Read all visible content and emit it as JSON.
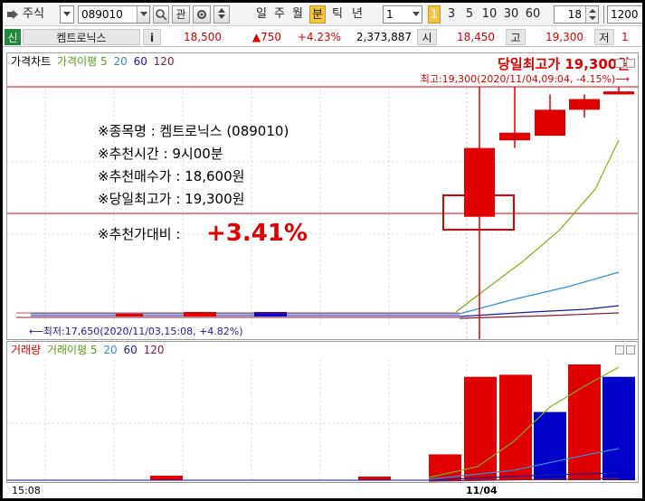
{
  "toolbar": {
    "market_label": "주식",
    "code_value": "089010",
    "gwan_label": "관",
    "periods": [
      "일",
      "주",
      "월",
      "분",
      "틱",
      "년"
    ],
    "active_period": "분",
    "interval_value": "1",
    "quick_intervals": [
      "1",
      "3",
      "5",
      "10",
      "30",
      "60"
    ],
    "count_value": "18",
    "max_value": "1200"
  },
  "quote": {
    "tag": "신",
    "name": "켐트로닉스",
    "info_icon": "i",
    "price": "18,500",
    "change": "▲750",
    "change_rate": "+4.23%",
    "volume": "2,373,887",
    "open_label": "시",
    "open": "18,450",
    "high_label": "고",
    "high": "19,300",
    "low_label": "저",
    "low_value": "1"
  },
  "price_panel": {
    "legend_title": "가격차트",
    "legend_ma_label": "가격이평 5",
    "legend_ma_periods": [
      "20",
      "60",
      "120"
    ],
    "headline": "당일최고가 19,300원",
    "high_note": "최고:19,300(2020/11/04,09:04, -4.15%)⟶",
    "low_note": "⟵최저:17,650(2020/11/03,15:08, +4.82%)",
    "info_lines": [
      "※종목명 : 켐트로닉스 (089010)",
      "※추천시간 : 9시00분",
      "※추천매수가 : 18,600원",
      "※당일최고가 : 19,300원"
    ],
    "compare_label": "※추천가대비 :",
    "compare_value": "+3.41%"
  },
  "volume_panel": {
    "legend_title": "거래량",
    "legend_ma_label": "거래이평 5",
    "legend_ma_periods": [
      "20",
      "60",
      "120"
    ]
  },
  "x_axis": {
    "left_label": "15:08",
    "mid_label": "11/04"
  },
  "colors": {
    "up": "#e00000",
    "down": "#0000c8",
    "ma5": "#7ab317",
    "ma20": "#2f8fd8",
    "ma60": "#1a1aa0",
    "ma120": "#8b1a3a",
    "accent": "#e00000"
  },
  "chart_data": {
    "type": "candlestick",
    "note": "values estimated from pixels; left segment is the prior day's flat close",
    "candles": [
      {
        "open": 18450,
        "high": 19300,
        "low": 17650,
        "close": 18900,
        "dir": "up"
      },
      {
        "open": 18950,
        "high": 19300,
        "low": 18900,
        "close": 19000,
        "dir": "up"
      },
      {
        "open": 18980,
        "high": 19250,
        "low": 18980,
        "close": 19150,
        "dir": "up"
      },
      {
        "open": 19150,
        "high": 19250,
        "low": 19100,
        "close": 19220,
        "dir": "up"
      },
      {
        "open": 19250,
        "high": 19300,
        "low": 19250,
        "close": 19270,
        "dir": "flat"
      }
    ],
    "volume_bars": [
      {
        "value": 25,
        "dir": "up"
      },
      {
        "value": 100,
        "dir": "up"
      },
      {
        "value": 102,
        "dir": "up"
      },
      {
        "value": 66,
        "dir": "down"
      },
      {
        "value": 112,
        "dir": "up"
      },
      {
        "value": 100,
        "dir": "down"
      }
    ],
    "series": [
      {
        "name": "5"
      },
      {
        "name": "20"
      },
      {
        "name": "60"
      },
      {
        "name": "120"
      }
    ]
  }
}
